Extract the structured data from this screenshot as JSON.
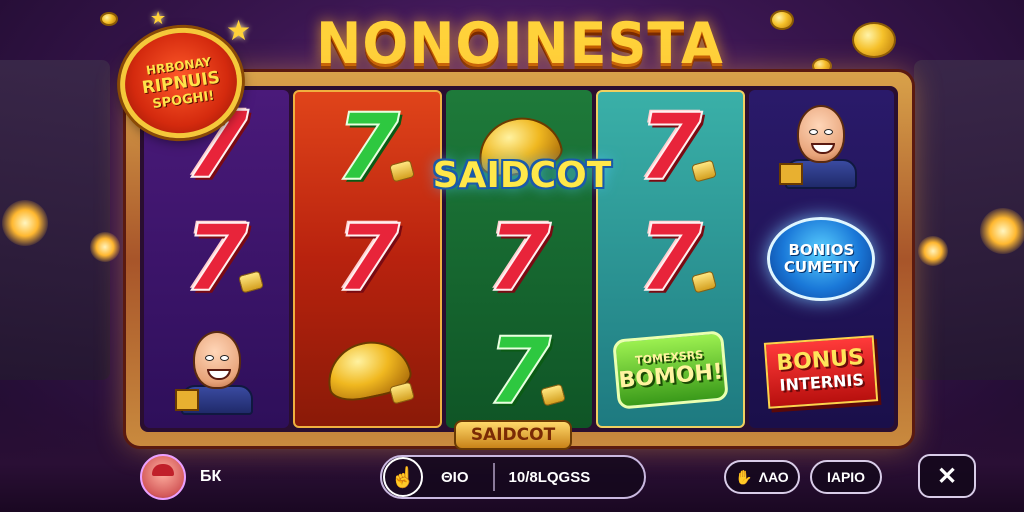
{
  "title": "NONOINESTA",
  "promo": {
    "line1": "HRBONAY",
    "line2": "RIPNUIS",
    "line3": "SPOGHI!"
  },
  "win_label": "SAIDCOT",
  "frame_plate": "SAIDCOT",
  "reels": {
    "reel0": [
      "7",
      "7",
      "character"
    ],
    "reel1": [
      "7",
      "7",
      "gem"
    ],
    "reel2": [
      "gem",
      "7",
      "7"
    ],
    "reel3": [
      "7",
      "7",
      "bonus"
    ],
    "reel4": [
      "character",
      "bonus-badge",
      "bonus-banner"
    ]
  },
  "bonus_badge": {
    "line1": "BONIOS",
    "line2": "CUMETIY"
  },
  "bonus_banner": {
    "line1": "BONUS",
    "line2": "INTERNIS"
  },
  "green_bonus": {
    "line1": "TOMEXSRS",
    "line2": "BOMOH!"
  },
  "player": {
    "name": "БК"
  },
  "spin_panel": {
    "spin_icon": "hand-pointer-icon",
    "balance": "ΘΙΟ",
    "bet": "10/8LQGSS"
  },
  "controls": {
    "auto_label": "ΛΑΟ",
    "auto_icon": "hand-icon",
    "info_label": "ΙΑΡΙΟ",
    "close_label": "✕"
  },
  "colors": {
    "title": "#ffd23a",
    "frame": "#d9a24a",
    "red_seven": "#e8243a",
    "green_seven": "#2ec840"
  }
}
